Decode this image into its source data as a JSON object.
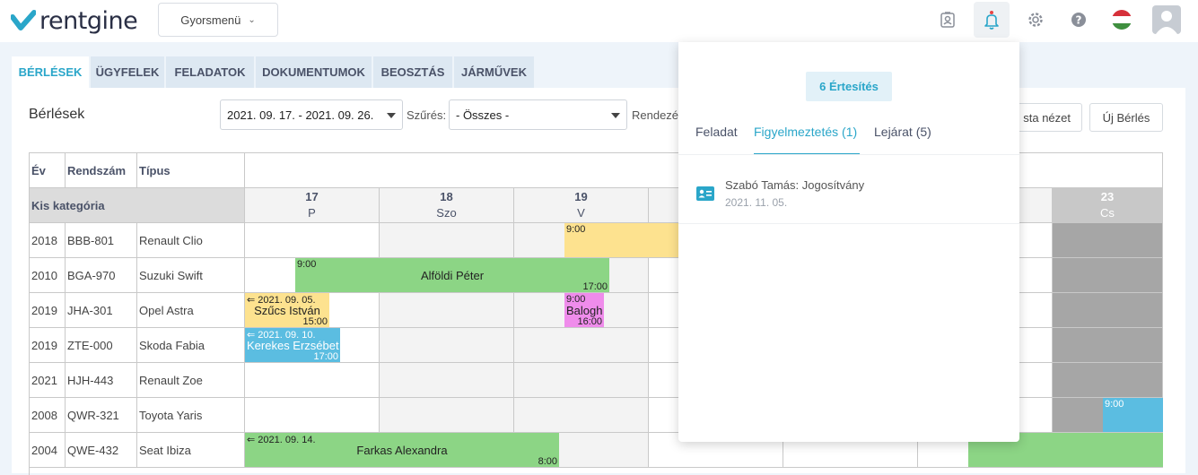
{
  "app": {
    "logo_text": "rentgine",
    "brand_color": "#2aa6c9"
  },
  "header": {
    "quick_menu": "Gyorsmenü",
    "icons": [
      "contacts-icon",
      "bell-icon",
      "gear-icon",
      "help-icon",
      "hungarian-flag-icon",
      "user-avatar-icon"
    ]
  },
  "tabs": [
    "BÉRLÉSEK",
    "ÜGYFELEK",
    "FELADATOK",
    "DOKUMENTUMOK",
    "BEOSZTÁS",
    "JÁRMŰVEK"
  ],
  "toolbar": {
    "title": "Bérlések",
    "date_range": "2021. 09. 17. - 2021. 09. 26.",
    "filter_label": "Szűrés:",
    "filter_value": "- Összes -",
    "sort_label": "Rendezé",
    "list_view_button": "sta nézet",
    "new_rental_button": "Új Bérlés"
  },
  "table": {
    "headers": {
      "year": "Év",
      "plate": "Rendszám",
      "type": "Típus"
    },
    "category": "Kis kategória",
    "days": [
      {
        "num": "17",
        "name": "P"
      },
      {
        "num": "18",
        "name": "Szo"
      },
      {
        "num": "19",
        "name": "V"
      },
      {
        "num": "23",
        "name": "Cs"
      }
    ],
    "rows": [
      {
        "year": "2018",
        "plate": "BBB-801",
        "type": "Renault Clio"
      },
      {
        "year": "2010",
        "plate": "BGA-970",
        "type": "Suzuki Swift"
      },
      {
        "year": "2019",
        "plate": "JHA-301",
        "type": "Opel Astra"
      },
      {
        "year": "2019",
        "plate": "ZTE-000",
        "type": "Skoda Fabia"
      },
      {
        "year": "2021",
        "plate": "HJH-443",
        "type": "Renault Zoe"
      },
      {
        "year": "2008",
        "plate": "QWR-321",
        "type": "Toyota Yaris"
      },
      {
        "year": "2004",
        "plate": "QWE-432",
        "type": "Seat Ibiza"
      }
    ],
    "bookings": [
      {
        "start": "9:00",
        "name": "",
        "end": ""
      },
      {
        "start": "9:00",
        "name": "Alföldi Péter",
        "end": "17:00"
      },
      {
        "start": "⇐ 2021. 09. 05.",
        "name": "Szűcs István",
        "end": "15:00"
      },
      {
        "start": "9:00",
        "name": "Balogh",
        "end": "16:00"
      },
      {
        "start": "⇐ 2021. 09. 10.",
        "name": "Kerekes Erzsébet",
        "end": "17:00"
      },
      {
        "start": "9:00",
        "name": "",
        "end": ""
      },
      {
        "start": "⇐ 2021. 09. 14.",
        "name": "Farkas Alexandra",
        "end": "8:00"
      }
    ]
  },
  "notifications": {
    "count_label": "6 Értesítés",
    "tabs": [
      "Feladat",
      "Figyelmeztetés (1)",
      "Lejárat (5)"
    ],
    "items": [
      {
        "title": "Szabó Tamás: Jogosítvány",
        "date": "2021. 11. 05."
      }
    ]
  }
}
